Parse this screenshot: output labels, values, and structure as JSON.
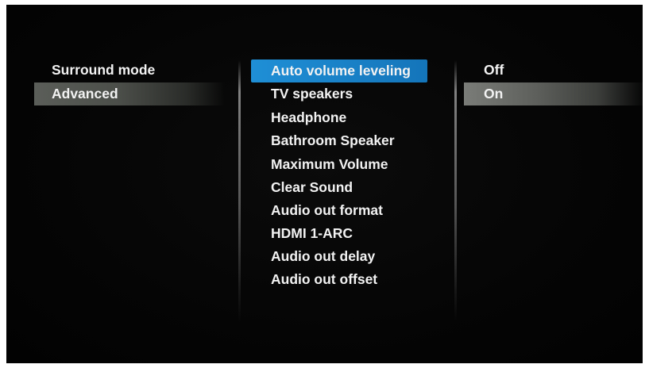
{
  "left_menu": {
    "items": [
      {
        "label": "Surround mode"
      },
      {
        "label": "Advanced"
      }
    ]
  },
  "middle_menu": {
    "items": [
      {
        "label": "Auto volume leveling"
      },
      {
        "label": "TV speakers"
      },
      {
        "label": "Headphone"
      },
      {
        "label": "Bathroom Speaker"
      },
      {
        "label": "Maximum Volume"
      },
      {
        "label": "Clear Sound"
      },
      {
        "label": "Audio out format"
      },
      {
        "label": "HDMI 1-ARC"
      },
      {
        "label": "Audio out delay"
      },
      {
        "label": "Audio out offset"
      }
    ]
  },
  "right_menu": {
    "items": [
      {
        "label": "Off"
      },
      {
        "label": "On"
      }
    ]
  },
  "colors": {
    "focus_highlight": "#1f8fd6",
    "selected_highlight": "#5b5e59",
    "text": "#f2f2f2",
    "background": "#050505"
  }
}
